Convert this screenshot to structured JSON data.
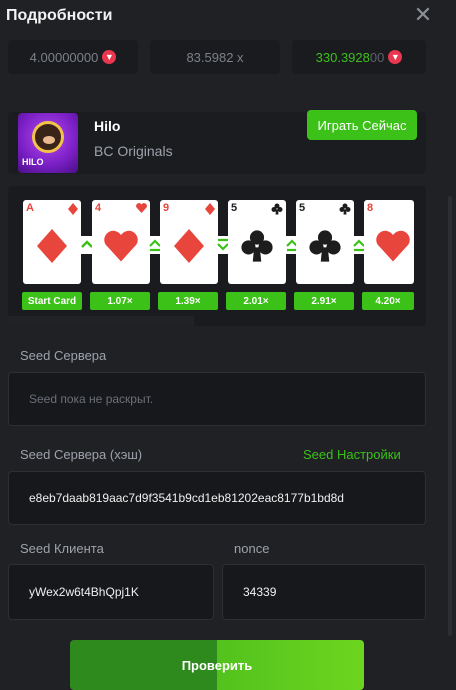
{
  "header": {
    "title": "Подробности"
  },
  "stats": [
    {
      "value": "4.00000000",
      "coin": true
    },
    {
      "value": "83.5982 x",
      "coin": false
    },
    {
      "value_main": "330.3928",
      "value_dim": "00",
      "coin": true
    }
  ],
  "game": {
    "name": "Hilo",
    "provider": "BC Originals",
    "play_label": "Играть Сейчас",
    "icon_text": "HILO"
  },
  "cards": [
    {
      "rank": "A",
      "suit": "diamond",
      "color": "red"
    },
    {
      "rank": "4",
      "suit": "heart",
      "color": "red"
    },
    {
      "rank": "9",
      "suit": "diamond",
      "color": "red"
    },
    {
      "rank": "5",
      "suit": "club",
      "color": "dark"
    },
    {
      "rank": "5",
      "suit": "club",
      "color": "dark"
    },
    {
      "rank": "8",
      "suit": "heart",
      "color": "red"
    }
  ],
  "multipliers": [
    "Start Card",
    "1.07×",
    "1.39×",
    "2.01×",
    "2.91×",
    "4.20×"
  ],
  "server_seed": {
    "label": "Seed Сервера",
    "value": "Seed пока не раскрыт."
  },
  "server_hash": {
    "label": "Seed Сервера (хэш)",
    "settings_link": "Seed Настройки",
    "value": "e8eb7daab819aac7d9f3541b9cd1eb81202eac8177b1bd8d"
  },
  "client_seed": {
    "label": "Seed Клиента",
    "value": "yWex2w6t4BhQpj1K"
  },
  "nonce": {
    "label": "nonce",
    "value": "34339"
  },
  "verify_label": "Проверить",
  "colors": {
    "accent": "#3bc117",
    "red_suit": "#e8453c"
  }
}
